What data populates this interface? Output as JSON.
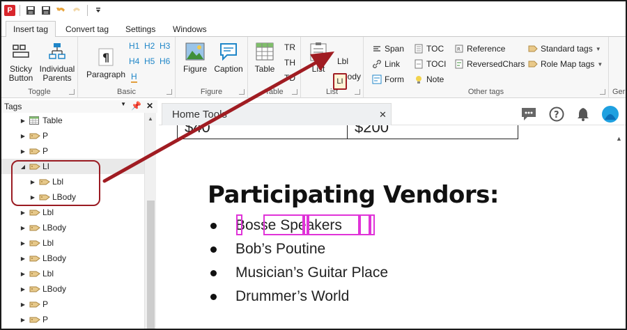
{
  "app": {
    "icon_label": "P"
  },
  "tabs": [
    {
      "label": "Insert tag",
      "active": true
    },
    {
      "label": "Convert tag",
      "active": false
    },
    {
      "label": "Settings",
      "active": false
    },
    {
      "label": "Windows",
      "active": false
    }
  ],
  "ribbon": {
    "toggle": {
      "label": "Toggle",
      "sticky": "Sticky\nButton",
      "sticky_l1": "Sticky",
      "sticky_l2": "Button",
      "ip_l1": "Individual",
      "ip_l2": "Parents"
    },
    "basic": {
      "label": "Basic",
      "paragraph": "Paragraph",
      "h": [
        "H1",
        "H2",
        "H3",
        "H4",
        "H5",
        "H6",
        "H"
      ]
    },
    "figure": {
      "label": "Figure",
      "figure": "Figure",
      "caption": "Caption"
    },
    "table": {
      "label": "Table",
      "table": "Table",
      "tr": "TR",
      "th": "TH",
      "td": "TD"
    },
    "list": {
      "label": "List",
      "list": "List",
      "li": "LI",
      "lbl": "Lbl",
      "lbody": "LBody"
    },
    "other": {
      "label": "Other tags",
      "span": "Span",
      "link": "Link",
      "form": "Form",
      "toc": "TOC",
      "toci": "TOCI",
      "note": "Note",
      "reference": "Reference",
      "reversed": "ReversedChars",
      "standard": "Standard tags",
      "rolemap": "Role Map tags"
    },
    "overflow_label": "Ger"
  },
  "tags_panel": {
    "title": "Tags",
    "rows": [
      {
        "label": "Table",
        "indent": 0,
        "icon": "table-icon",
        "arrow": "collapsed"
      },
      {
        "label": "P",
        "indent": 0,
        "icon": "tag-icon",
        "arrow": "collapsed"
      },
      {
        "label": "P",
        "indent": 0,
        "icon": "tag-icon",
        "arrow": "collapsed"
      },
      {
        "label": "LI",
        "indent": 0,
        "icon": "tag-icon",
        "arrow": "expanded"
      },
      {
        "label": "Lbl",
        "indent": 1,
        "icon": "tag-icon",
        "arrow": "collapsed"
      },
      {
        "label": "LBody",
        "indent": 1,
        "icon": "tag-icon",
        "arrow": "collapsed"
      },
      {
        "label": "Lbl",
        "indent": 0,
        "icon": "tag-icon",
        "arrow": "collapsed"
      },
      {
        "label": "LBody",
        "indent": 0,
        "icon": "tag-icon",
        "arrow": "collapsed"
      },
      {
        "label": "Lbl",
        "indent": 0,
        "icon": "tag-icon",
        "arrow": "collapsed"
      },
      {
        "label": "LBody",
        "indent": 0,
        "icon": "tag-icon",
        "arrow": "collapsed"
      },
      {
        "label": "Lbl",
        "indent": 0,
        "icon": "tag-icon",
        "arrow": "collapsed"
      },
      {
        "label": "LBody",
        "indent": 0,
        "icon": "tag-icon",
        "arrow": "collapsed"
      },
      {
        "label": "P",
        "indent": 0,
        "icon": "tag-icon",
        "arrow": "collapsed"
      },
      {
        "label": "P",
        "indent": 0,
        "icon": "tag-icon",
        "arrow": "collapsed"
      }
    ]
  },
  "doc_tab": {
    "label": "Home Tools"
  },
  "document": {
    "prices": [
      "$40",
      "$200"
    ],
    "heading": "Participating Vendors:",
    "vendors": [
      "Bosse Speakers",
      "Bob’s Poutine",
      "Musician’s Guitar Place",
      "Drummer’s World"
    ]
  },
  "colors": {
    "accent_blue": "#1f86c8",
    "callout_red": "#a01c22",
    "highlight_magenta": "#e033d8"
  }
}
